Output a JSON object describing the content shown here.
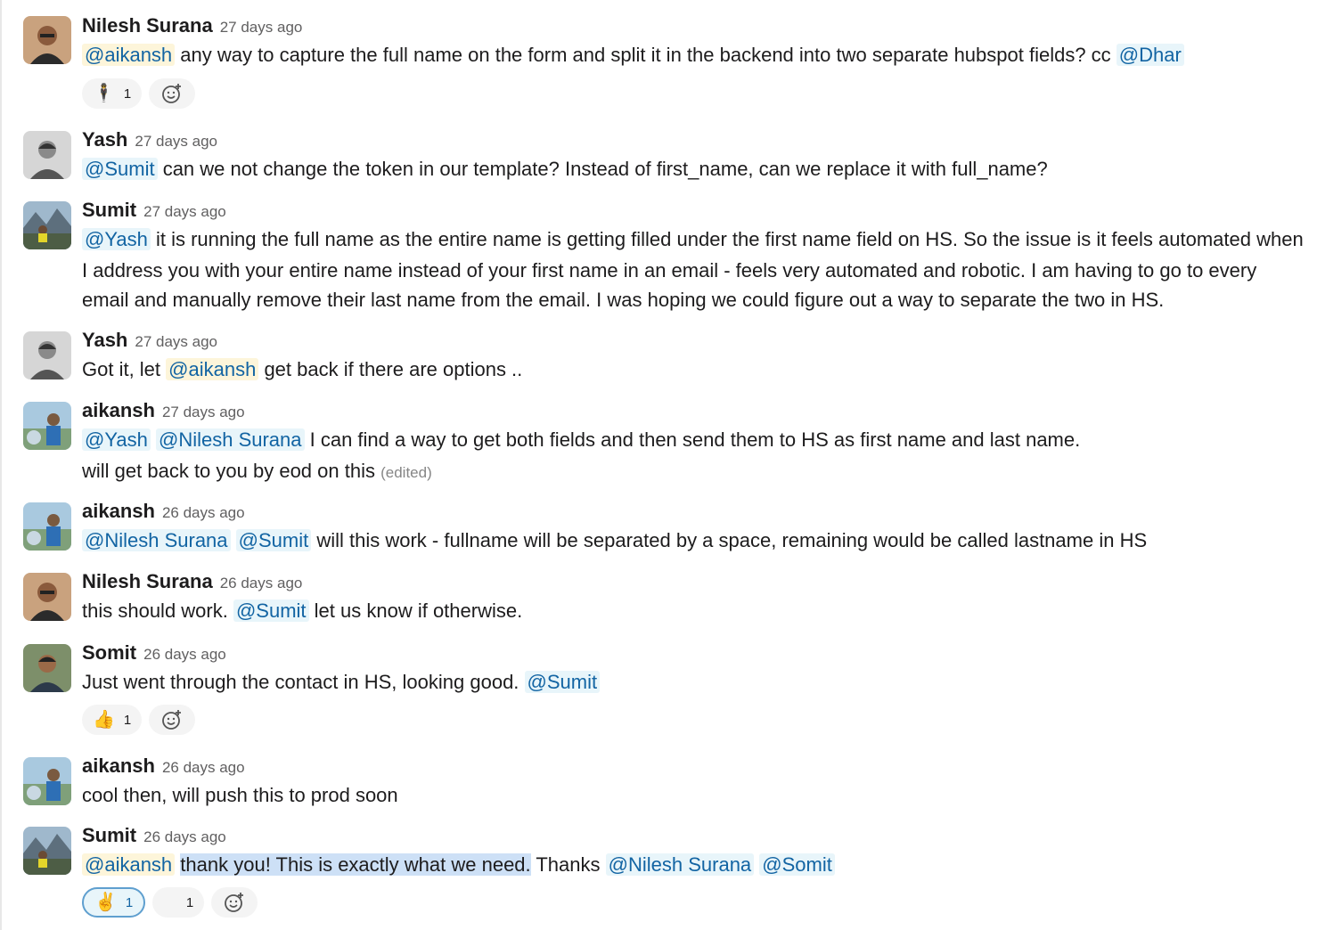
{
  "messages": [
    {
      "author": "Nilesh Surana",
      "time": "27 days ago",
      "line1": {
        "mention_a": "@aikansh",
        "text_a": " any way to capture the full name on the form and split it in the backend into two separate hubspot fields? cc ",
        "mention_b": "@Dhar"
      },
      "reactions": [
        {
          "emoji": "🕴",
          "count": "1"
        }
      ]
    },
    {
      "author": "Yash",
      "time": "27 days ago",
      "line1": {
        "mention_a": "@Sumit",
        "text_a": " can we not change the token in our template? Instead of first_name, can  we replace it with full_name?"
      }
    },
    {
      "author": "Sumit",
      "time": "27 days ago",
      "line1": {
        "mention_a": "@Yash",
        "text_a": " it is running the full name as the entire name is getting filled under the first name field on HS. So the issue is it feels automated when"
      },
      "line2": "I address you with your entire name instead of your first name in an email - feels very automated and robotic. I am having to go to every",
      "line3": "email and manually remove their last name from the email. I was hoping we could figure out a way to separate the two in HS."
    },
    {
      "author": "Yash",
      "time": "27 days ago",
      "line1": {
        "text_pre": "Got it, let ",
        "mention_a": "@aikansh",
        "text_a": " get back if there are options .."
      }
    },
    {
      "author": "aikansh",
      "time": "27 days ago",
      "line1": {
        "mention_a": "@Yash",
        "mention_b": "@Nilesh Surana",
        "text_a": " I can find a way to get both fields and then send them to HS as first name and last name."
      },
      "line2": "will get back to you by eod on this",
      "edited": "(edited)"
    },
    {
      "author": "aikansh",
      "time": "26 days ago",
      "line1": {
        "mention_a": "@Nilesh Surana",
        "mention_b": "@Sumit",
        "text_a": " will this work - fullname will be separated by a space, remaining would be called lastname in HS"
      }
    },
    {
      "author": "Nilesh Surana",
      "time": "26 days ago",
      "line1": {
        "text_pre": "this should work. ",
        "mention_a": "@Sumit",
        "text_a": " let us know if otherwise."
      }
    },
    {
      "author": "Somit",
      "time": "26 days ago",
      "line1": {
        "text_pre": "Just went through the contact in HS, looking good. ",
        "mention_a": "@Sumit"
      },
      "reactions": [
        {
          "emoji": "👍",
          "count": "1"
        }
      ]
    },
    {
      "author": "aikansh",
      "time": "26 days ago",
      "line1": {
        "text_pre": "cool then, will push this to prod soon"
      }
    },
    {
      "author": "Sumit",
      "time": "26 days ago",
      "line1": {
        "mention_a": "@aikansh",
        "highlight": "thank you! This is exactly what we need.",
        "text_a": " Thanks ",
        "mention_b": "@Nilesh Surana",
        "mention_c": "@Somit"
      },
      "reactions": [
        {
          "emoji": "✌️",
          "count": "1"
        },
        {
          "emoji": "",
          "count": "1"
        }
      ]
    }
  ],
  "add_reaction_icon": "add-emoji-icon",
  "colors": {
    "mention": "#1264a3",
    "mention_bg": "#e8f5fa",
    "self_mention_bg": "#fdf5da",
    "highlight": "#cde0f6"
  }
}
